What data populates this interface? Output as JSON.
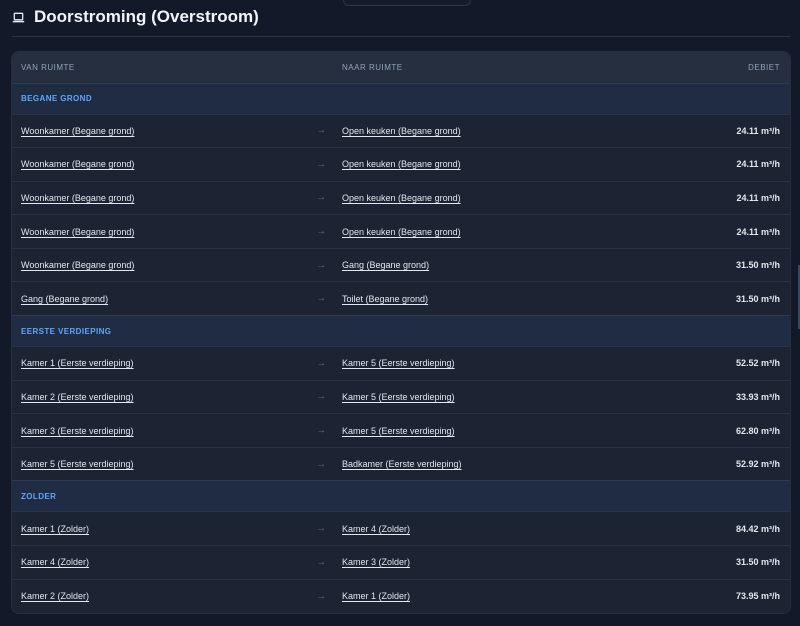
{
  "page": {
    "title": "Doorstroming (Overstroom)"
  },
  "table": {
    "headers": {
      "from": "VAN RUIMTE",
      "to": "NAAR RUIMTE",
      "flow": "DEBIET"
    },
    "arrow": "→",
    "groups": [
      {
        "name": "BEGANE GROND",
        "rows": [
          {
            "from": "Woonkamer (Begane grond)",
            "to": "Open keuken (Begane grond)",
            "flow": "24.11 m³/h"
          },
          {
            "from": "Woonkamer (Begane grond)",
            "to": "Open keuken (Begane grond)",
            "flow": "24.11 m³/h"
          },
          {
            "from": "Woonkamer (Begane grond)",
            "to": "Open keuken (Begane grond)",
            "flow": "24.11 m³/h"
          },
          {
            "from": "Woonkamer (Begane grond)",
            "to": "Open keuken (Begane grond)",
            "flow": "24.11 m³/h"
          },
          {
            "from": "Woonkamer (Begane grond)",
            "to": "Gang (Begane grond)",
            "flow": "31.50 m³/h"
          },
          {
            "from": "Gang (Begane grond)",
            "to": "Toilet (Begane grond)",
            "flow": "31.50 m³/h"
          }
        ]
      },
      {
        "name": "EERSTE VERDIEPING",
        "rows": [
          {
            "from": "Kamer 1 (Eerste verdieping)",
            "to": "Kamer 5 (Eerste verdieping)",
            "flow": "52.52 m³/h"
          },
          {
            "from": "Kamer 2 (Eerste verdieping)",
            "to": "Kamer 5 (Eerste verdieping)",
            "flow": "33.93 m³/h"
          },
          {
            "from": "Kamer 3 (Eerste verdieping)",
            "to": "Kamer 5 (Eerste verdieping)",
            "flow": "62.80 m³/h"
          },
          {
            "from": "Kamer 5 (Eerste verdieping)",
            "to": "Badkamer (Eerste verdieping)",
            "flow": "52.92 m³/h"
          }
        ]
      },
      {
        "name": "ZOLDER",
        "rows": [
          {
            "from": "Kamer 1 (Zolder)",
            "to": "Kamer 4 (Zolder)",
            "flow": "84.42 m³/h"
          },
          {
            "from": "Kamer 4 (Zolder)",
            "to": "Kamer 3 (Zolder)",
            "flow": "31.50 m³/h"
          },
          {
            "from": "Kamer 2 (Zolder)",
            "to": "Kamer 1 (Zolder)",
            "flow": "73.95 m³/h"
          }
        ]
      }
    ]
  }
}
